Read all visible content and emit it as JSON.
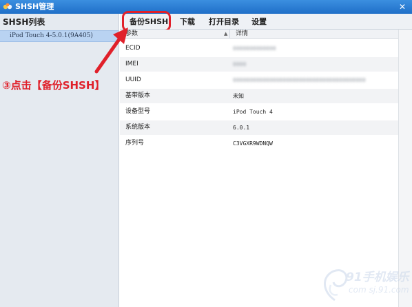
{
  "window": {
    "title": "SHSH管理",
    "close_glyph": "✕"
  },
  "sidebar": {
    "heading": "SHSH列表",
    "items": [
      {
        "label": "iPod Touch 4-5.0.1(9A405)",
        "selected": true
      }
    ]
  },
  "tabs": [
    {
      "label": "备份SHSH",
      "highlighted": true
    },
    {
      "label": "下载"
    },
    {
      "label": "打开目录"
    },
    {
      "label": "设置"
    }
  ],
  "table": {
    "columns": [
      "参数",
      "详情"
    ],
    "sort_glyph": "▲",
    "rows": [
      {
        "param": "ECID",
        "value": "0000000000000",
        "redacted": true
      },
      {
        "param": "IMEI",
        "value": "0000",
        "redacted": true
      },
      {
        "param": "UUID",
        "value": "0000000000000000000000000000000000000000",
        "redacted": true
      },
      {
        "param": "基带版本",
        "value": "未知",
        "redacted": false
      },
      {
        "param": "设备型号",
        "value": "iPod Touch 4",
        "redacted": false
      },
      {
        "param": "系统版本",
        "value": "6.0.1",
        "redacted": false
      },
      {
        "param": "序列号",
        "value": "C3VGXR9WDNQW",
        "redacted": false
      }
    ]
  },
  "annotation": {
    "text": "③点击【备份SHSH】",
    "color": "#e0202a"
  },
  "watermark": {
    "main": "91手机娱乐",
    "sub": "com   sj.91.com"
  },
  "colors": {
    "titlebar": "#2a7fd6",
    "selection": "#b9d3f2",
    "highlight": "#e0202a"
  }
}
